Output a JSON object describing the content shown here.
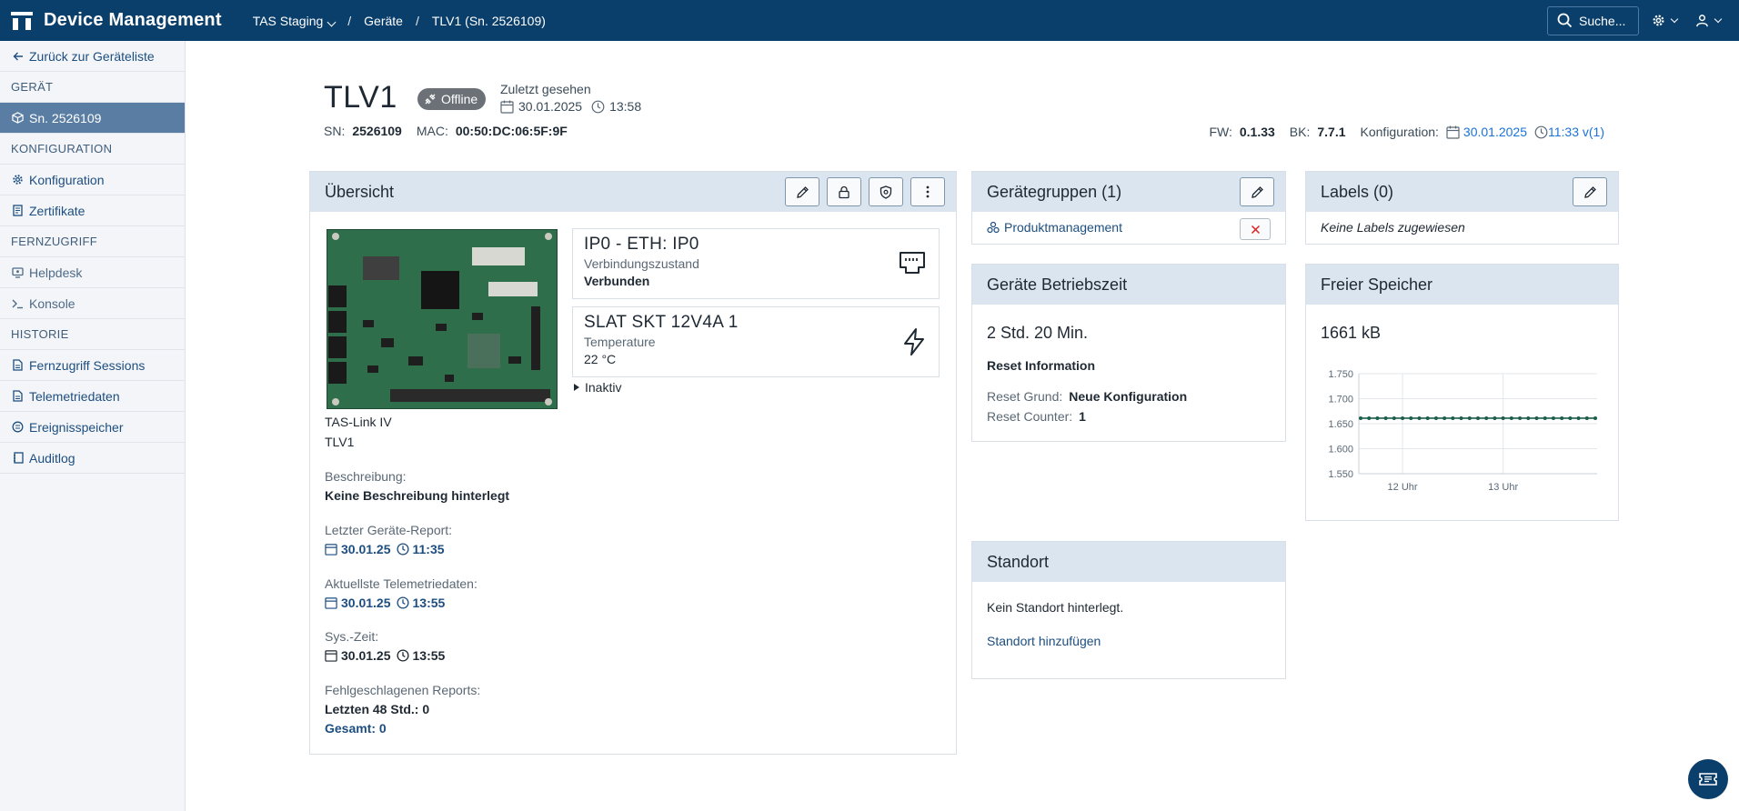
{
  "app": {
    "title": "Device Management",
    "breadcrumb": [
      "TAS Staging",
      "Geräte",
      "TLV1 (Sn. 2526109)"
    ],
    "search_label": "Suche..."
  },
  "sidebar": {
    "back": "Zurück zur Geräteliste",
    "sections": {
      "geraet": "GERÄT",
      "konfiguration": "KONFIGURATION",
      "fernzugriff": "FERNZUGRIFF",
      "historie": "HISTORIE"
    },
    "items": {
      "sn": "Sn. 2526109",
      "konfiguration": "Konfiguration",
      "zertifikate": "Zertifikate",
      "helpdesk": "Helpdesk",
      "konsole": "Konsole",
      "sessions": "Fernzugriff Sessions",
      "telemetrie": "Telemetriedaten",
      "ereignis": "Ereignisspeicher",
      "auditlog": "Auditlog"
    }
  },
  "device": {
    "name": "TLV1",
    "status": "Offline",
    "last_seen_label": "Zuletzt gesehen",
    "last_seen_date": "30.01.2025",
    "last_seen_time": "13:58",
    "sn_label": "SN:",
    "sn": "2526109",
    "mac_label": "MAC:",
    "mac": "00:50:DC:06:5F:9F",
    "fw_label": "FW:",
    "fw": "0.1.33",
    "bk_label": "BK:",
    "bk": "7.7.1",
    "config_label": "Konfiguration:",
    "config_date": "30.01.2025",
    "config_time": "11:33 v(1)"
  },
  "overview": {
    "title": "Übersicht",
    "model": "TAS-Link IV",
    "name": "TLV1",
    "desc_label": "Beschreibung:",
    "desc": "Keine Beschreibung hinterlegt",
    "report_label": "Letzter Geräte-Report:",
    "report_date": "30.01.25",
    "report_time": "11:35",
    "telemetry_label": "Aktuellste Telemetriedaten:",
    "telemetry_date": "30.01.25",
    "telemetry_time": "13:55",
    "systime_label": "Sys.-Zeit:",
    "systime_date": "30.01.25",
    "systime_time": "13:55",
    "failed_label": "Fehlgeschlagenen Reports:",
    "failed_48": "Letzten 48 Std.: 0",
    "failed_total": "Gesamt: 0",
    "io1_title": "IP0 - ETH: IP0",
    "io1_label": "Verbindungszustand",
    "io1_value": "Verbunden",
    "io2_title": "SLAT SKT 12V4A 1",
    "io2_label": "Temperature",
    "io2_value": "22  °C",
    "inactive": "Inaktiv"
  },
  "groups": {
    "title": "Gerätegruppen (1)",
    "item": "Produktmanagement"
  },
  "labels": {
    "title": "Labels (0)",
    "empty": "Keine Labels zugewiesen"
  },
  "uptime": {
    "title": "Geräte Betriebszeit",
    "value": "2 Std. 20 Min.",
    "reset_info": "Reset Information",
    "reset_reason_label": "Reset Grund:",
    "reset_reason": "Neue Konfiguration",
    "reset_counter_label": "Reset Counter:",
    "reset_counter": "1"
  },
  "memory": {
    "title": "Freier Speicher",
    "value": "1661 kB"
  },
  "location": {
    "title": "Standort",
    "empty": "Kein Standort hinterlegt.",
    "add": "Standort hinzufügen"
  },
  "chart_data": {
    "type": "line",
    "x": [
      "11:35",
      "11:40",
      "11:45",
      "11:50",
      "11:55",
      "12:00",
      "12:05",
      "12:10",
      "12:15",
      "12:20",
      "12:25",
      "12:30",
      "12:35",
      "12:40",
      "12:45",
      "12:50",
      "12:55",
      "13:00",
      "13:05",
      "13:10",
      "13:15",
      "13:20",
      "13:25",
      "13:30",
      "13:35",
      "13:40",
      "13:45",
      "13:50",
      "13:55"
    ],
    "series": [
      {
        "values": [
          1661,
          1661,
          1661,
          1661,
          1661,
          1661,
          1661,
          1661,
          1661,
          1661,
          1661,
          1661,
          1661,
          1661,
          1661,
          1661,
          1661,
          1661,
          1661,
          1661,
          1661,
          1661,
          1661,
          1661,
          1661,
          1661,
          1661,
          1661,
          1661
        ]
      }
    ],
    "ylim": [
      1550,
      1750
    ],
    "yticks": [
      "1.750",
      "1.700",
      "1.650",
      "1.600",
      "1.550"
    ],
    "xticks": [
      "12 Uhr",
      "13 Uhr"
    ],
    "grid": true,
    "color": "#1b5e4a"
  }
}
